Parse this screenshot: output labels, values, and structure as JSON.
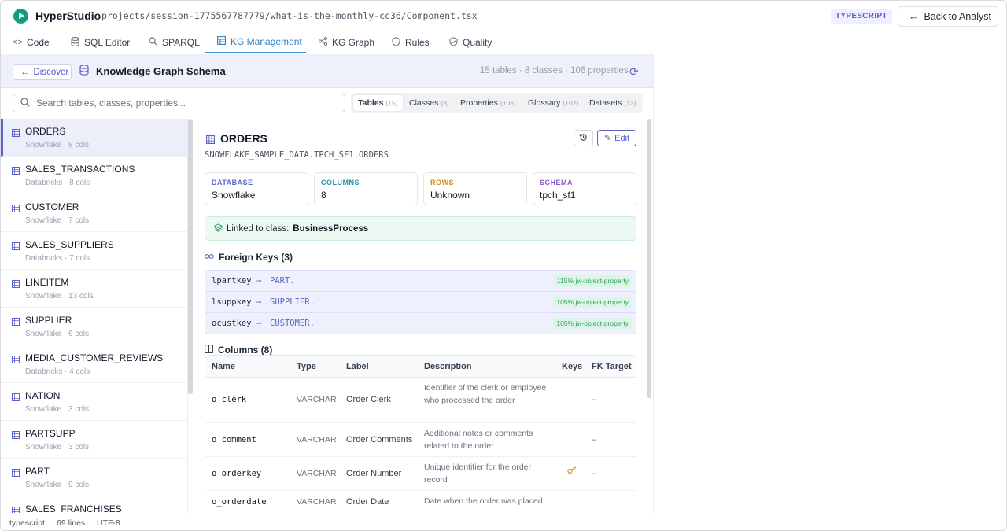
{
  "app": {
    "name": "HyperStudio",
    "file_path": "projects/session-1775567787779/what-is-the-monthly-cc36/Component.tsx",
    "language_badge": "TYPESCRIPT",
    "back_label": "Back to Analyst"
  },
  "tabs": [
    {
      "label": "Code",
      "icon": "code-icon"
    },
    {
      "label": "SQL Editor",
      "icon": "database-icon"
    },
    {
      "label": "SPARQL",
      "icon": "search-icon"
    },
    {
      "label": "KG Management",
      "icon": "grid-icon",
      "active": true
    },
    {
      "label": "KG Graph",
      "icon": "share-icon"
    },
    {
      "label": "Rules",
      "icon": "shield-icon"
    },
    {
      "label": "Quality",
      "icon": "check-shield-icon"
    }
  ],
  "schema": {
    "discover_label": "Discover",
    "title": "Knowledge Graph Schema",
    "stats": "15 tables · 8 classes · 106 properties"
  },
  "search": {
    "placeholder": "Search tables, classes, properties..."
  },
  "filter_tabs": [
    {
      "label": "Tables",
      "count": "(15)",
      "active": true
    },
    {
      "label": "Classes",
      "count": "(8)"
    },
    {
      "label": "Properties",
      "count": "(106)"
    },
    {
      "label": "Glossary",
      "count": "(102)"
    },
    {
      "label": "Datasets",
      "count": "(12)"
    }
  ],
  "tables": [
    {
      "name": "ORDERS",
      "meta": "Snowflake · 8 cols",
      "active": true
    },
    {
      "name": "SALES_TRANSACTIONS",
      "meta": "Databricks · 8 cols"
    },
    {
      "name": "CUSTOMER",
      "meta": "Snowflake · 7 cols"
    },
    {
      "name": "SALES_SUPPLIERS",
      "meta": "Databricks · 7 cols"
    },
    {
      "name": "LINEITEM",
      "meta": "Snowflake · 13 cols"
    },
    {
      "name": "SUPPLIER",
      "meta": "Snowflake · 6 cols"
    },
    {
      "name": "MEDIA_CUSTOMER_REVIEWS",
      "meta": "Databricks · 4 cols"
    },
    {
      "name": "NATION",
      "meta": "Snowflake · 3 cols"
    },
    {
      "name": "PARTSUPP",
      "meta": "Snowflake · 3 cols"
    },
    {
      "name": "PART",
      "meta": "Snowflake · 9 cols"
    },
    {
      "name": "SALES_FRANCHISES",
      "meta": ""
    }
  ],
  "detail": {
    "title": "ORDERS",
    "edit_label": "Edit",
    "path": "SNOWFLAKE_SAMPLE_DATA.TPCH_SF1.ORDERS",
    "cards": [
      {
        "key": "DATABASE",
        "value": "Snowflake",
        "color": "#5b63c9"
      },
      {
        "key": "COLUMNS",
        "value": "8",
        "color": "#2f8fb0"
      },
      {
        "key": "ROWS",
        "value": "Unknown",
        "color": "#d08a1a"
      },
      {
        "key": "SCHEMA",
        "value": "tpch_sf1",
        "color": "#8a55c9"
      }
    ],
    "linked_prefix": "Linked to class:",
    "linked_class": "BusinessProcess",
    "fk_title": "Foreign Keys (3)",
    "foreign_keys": [
      {
        "column": "lpartkey",
        "arrow": "→",
        "target": "PART.",
        "badge": "115% jw-object-property"
      },
      {
        "column": "lsuppkey",
        "arrow": "→",
        "target": "SUPPLIER.",
        "badge": "105% jw-object-property"
      },
      {
        "column": "ocustkey",
        "arrow": "→",
        "target": "CUSTOMER.",
        "badge": "105% jw-object-property"
      }
    ],
    "columns_title": "Columns (8)",
    "column_headers": [
      "Name",
      "Type",
      "Label",
      "Description",
      "Keys",
      "FK Target"
    ],
    "columns": [
      {
        "name": "o_clerk",
        "type": "VARCHAR",
        "label": "Order Clerk",
        "description": "Identifier of the clerk or employee who processed the order",
        "key": "",
        "fk": "–"
      },
      {
        "name": "o_comment",
        "type": "VARCHAR",
        "label": "Order Comments",
        "description": "Additional notes or comments related to the order",
        "key": "",
        "fk": "–"
      },
      {
        "name": "o_orderkey",
        "type": "VARCHAR",
        "label": "Order Number",
        "description": "Unique identifier for the order record",
        "key": "key-icon",
        "fk": "–"
      },
      {
        "name": "o_orderdate",
        "type": "VARCHAR",
        "label": "Order Date",
        "description": "Date when the order was placed",
        "key": "",
        "fk": ""
      }
    ]
  },
  "status": {
    "language": "typescript",
    "lines": "69 lines",
    "encoding": "UTF-8"
  }
}
